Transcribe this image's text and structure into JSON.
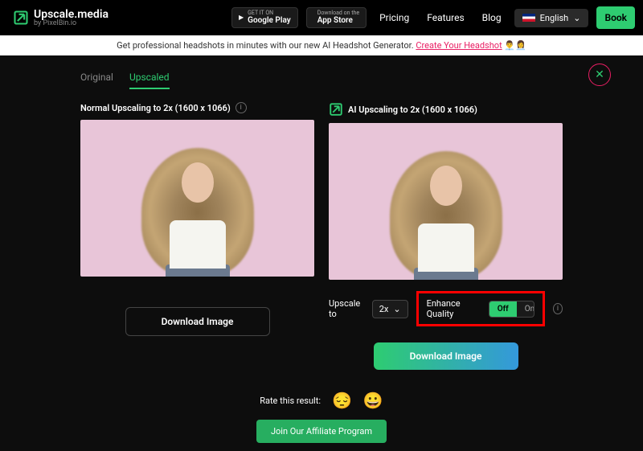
{
  "header": {
    "brand": "Upscale.media",
    "brand_sub": "by PixelBin.io",
    "gplay_top": "GET IT ON",
    "gplay_bottom": "Google Play",
    "appstore_top": "Download on the",
    "appstore_bottom": "App Store",
    "nav": {
      "pricing": "Pricing",
      "features": "Features",
      "blog": "Blog"
    },
    "language": "English",
    "book": "Book"
  },
  "banner": {
    "text": "Get professional headshots in minutes with our new AI Headshot Generator. ",
    "link": "Create Your Headshot"
  },
  "tabs": {
    "original": "Original",
    "upscaled": "Upscaled"
  },
  "left": {
    "title": "Normal Upscaling to 2x (1600 x 1066)",
    "download": "Download Image"
  },
  "right": {
    "title": "AI Upscaling to 2x (1600 x 1066)",
    "upscale_label": "Upscale to",
    "upscale_value": "2x",
    "enhance_label": "Enhance Quality",
    "enhance_off": "Off",
    "enhance_on": "On",
    "download": "Download Image"
  },
  "rating": {
    "label": "Rate this result:"
  },
  "affiliate": "Join Our Affiliate Program",
  "emojis": {
    "sad": "😔",
    "happy": "😀",
    "people": "👨‍💼👩‍💼"
  }
}
